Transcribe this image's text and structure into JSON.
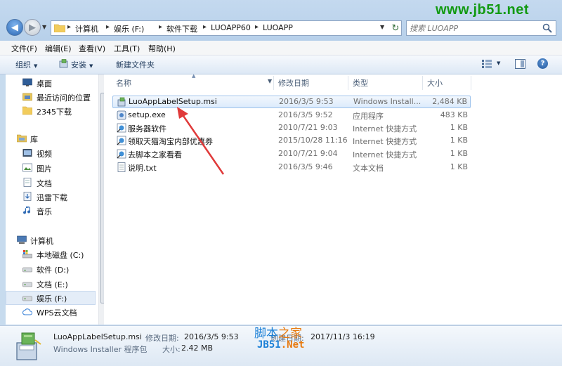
{
  "watermark": "www.jb51.net",
  "address": {
    "crumbs": [
      "计算机",
      "娱乐 (F:)",
      "软件下载",
      "LUOAPP60",
      "LUOAPP"
    ]
  },
  "search": {
    "placeholder": "搜索 LUOAPP"
  },
  "menu": [
    "文件(F)",
    "编辑(E)",
    "查看(V)",
    "工具(T)",
    "帮助(H)"
  ],
  "toolbar": {
    "organize": "组织",
    "install": "安装",
    "new_folder": "新建文件夹"
  },
  "sidebar": {
    "items": [
      {
        "label": "桌面",
        "icon": "desktop-icon"
      },
      {
        "label": "最近访问的位置",
        "icon": "recent-places-icon"
      },
      {
        "label": "2345下载",
        "icon": "folder-icon"
      },
      {
        "label": "库",
        "icon": "library-icon"
      },
      {
        "label": "视频",
        "icon": "video-icon"
      },
      {
        "label": "图片",
        "icon": "pictures-icon"
      },
      {
        "label": "文档",
        "icon": "documents-icon"
      },
      {
        "label": "迅雷下载",
        "icon": "xunlei-download-icon"
      },
      {
        "label": "音乐",
        "icon": "music-icon"
      },
      {
        "label": "计算机",
        "icon": "computer-icon"
      },
      {
        "label": "本地磁盘 (C:)",
        "icon": "system-drive-icon"
      },
      {
        "label": "软件 (D:)",
        "icon": "drive-icon"
      },
      {
        "label": "文档 (E:)",
        "icon": "drive-icon"
      },
      {
        "label": "娱乐 (F:)",
        "icon": "drive-icon"
      },
      {
        "label": "WPS云文档",
        "icon": "cloud-icon"
      }
    ]
  },
  "columns": {
    "name": "名称",
    "date": "修改日期",
    "type": "类型",
    "size": "大小"
  },
  "files": [
    {
      "name": "LuoAppLabelSetup.msi",
      "date": "2016/3/5 9:53",
      "type": "Windows Install...",
      "size": "2,484 KB",
      "icon": "msi-installer-icon"
    },
    {
      "name": "setup.exe",
      "date": "2016/3/5 9:52",
      "type": "应用程序",
      "size": "483 KB",
      "icon": "setup-exe-icon"
    },
    {
      "name": "服务器软件",
      "date": "2010/7/21 9:03",
      "type": "Internet 快捷方式",
      "size": "1 KB",
      "icon": "internet-shortcut-icon"
    },
    {
      "name": "领取天猫淘宝内部优惠券",
      "date": "2015/10/28 11:16",
      "type": "Internet 快捷方式",
      "size": "1 KB",
      "icon": "internet-shortcut-icon"
    },
    {
      "name": "去脚本之家看看",
      "date": "2010/7/21 9:04",
      "type": "Internet 快捷方式",
      "size": "1 KB",
      "icon": "internet-shortcut-icon"
    },
    {
      "name": "说明.txt",
      "date": "2016/3/5 9:46",
      "type": "文本文档",
      "size": "1 KB",
      "icon": "text-file-icon"
    }
  ],
  "details": {
    "file_name": "LuoAppLabelSetup.msi",
    "modified_label": "修改日期:",
    "modified_value": "2016/3/5 9:53",
    "created_label": "创建日期:",
    "created_value": "2017/11/3 16:19",
    "type_text": "Windows Installer 程序包",
    "size_label": "大小:",
    "size_value": "2.42 MB"
  },
  "logo": {
    "line1_a": "脚本",
    "line1_b": "之家",
    "line2_a": "JB51",
    "line2_b": ".Net"
  },
  "colors": {
    "accent": "#1a7fd6",
    "watermark": "#129a12",
    "arrow": "#e03a3a",
    "selection": "#dcebfc"
  }
}
